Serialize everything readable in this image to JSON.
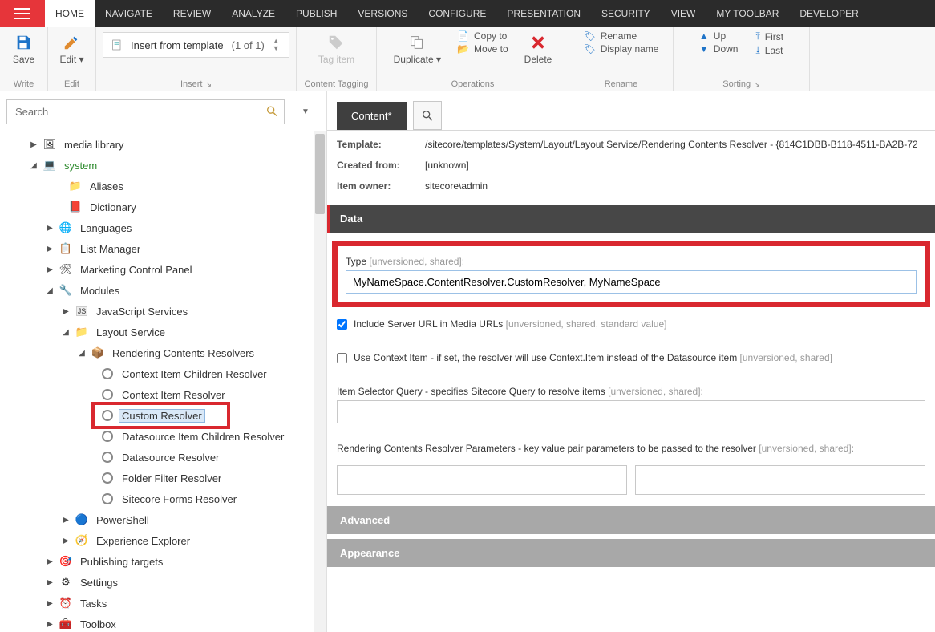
{
  "topMenu": {
    "items": [
      "HOME",
      "NAVIGATE",
      "REVIEW",
      "ANALYZE",
      "PUBLISH",
      "VERSIONS",
      "CONFIGURE",
      "PRESENTATION",
      "SECURITY",
      "VIEW",
      "MY TOOLBAR",
      "DEVELOPER"
    ],
    "activeIndex": 0
  },
  "ribbon": {
    "write": {
      "save": "Save",
      "group": "Write"
    },
    "edit": {
      "edit": "Edit",
      "group": "Edit"
    },
    "insert": {
      "label": "Insert from template",
      "count": "(1 of 1)",
      "group": "Insert"
    },
    "tagging": {
      "tag": "Tag item",
      "group": "Content Tagging"
    },
    "operations": {
      "duplicate": "Duplicate",
      "copy": "Copy to",
      "move": "Move to",
      "delete": "Delete",
      "group": "Operations"
    },
    "rename": {
      "rename": "Rename",
      "display": "Display name",
      "group": "Rename"
    },
    "sorting": {
      "up": "Up",
      "down": "Down",
      "first": "First",
      "last": "Last",
      "group": "Sorting"
    }
  },
  "search": {
    "placeholder": "Search"
  },
  "tree": {
    "n0": "media library",
    "n1": "system",
    "n2": "Aliases",
    "n3": "Dictionary",
    "n4": "Languages",
    "n5": "List Manager",
    "n6": "Marketing Control Panel",
    "n7": "Modules",
    "n8": "JavaScript Services",
    "n9": "Layout Service",
    "n10": "Rendering Contents Resolvers",
    "n11": "Context Item Children Resolver",
    "n12": "Context Item Resolver",
    "n13": "Custom Resolver",
    "n14": "Datasource Item Children Resolver",
    "n15": "Datasource Resolver",
    "n16": "Folder Filter Resolver",
    "n17": "Sitecore Forms Resolver",
    "n18": "PowerShell",
    "n19": "Experience Explorer",
    "n20": "Publishing targets",
    "n21": "Settings",
    "n22": "Tasks",
    "n23": "Toolbox"
  },
  "content": {
    "tab": "Content*",
    "meta": {
      "templateLabel": "Template:",
      "templateValue": "/sitecore/templates/System/Layout/Layout Service/Rendering Contents Resolver - {814C1DBB-B118-4511-BA2B-72",
      "createdLabel": "Created from:",
      "createdValue": "[unknown]",
      "ownerLabel": "Item owner:",
      "ownerValue": "sitecore\\admin"
    },
    "sections": {
      "data": "Data",
      "advanced": "Advanced",
      "appearance": "Appearance"
    },
    "fields": {
      "typeLabel": "Type",
      "typeHint": "[unversioned, shared]:",
      "typeValue": "MyNameSpace.ContentResolver.CustomResolver, MyNameSpace",
      "includeLabel": "Include Server URL in Media URLs",
      "includeHint": "[unversioned, shared, standard value]",
      "useContextLabel": "Use Context Item - if set, the resolver will use Context.Item instead of the Datasource item",
      "useContextHint": "[unversioned, shared]",
      "selectorLabel": "Item Selector Query - specifies Sitecore Query to resolve items",
      "selectorHint": "[unversioned, shared]:",
      "paramsLabel": "Rendering Contents Resolver Parameters - key value pair parameters to be passed to the resolver",
      "paramsHint": "[unversioned, shared]:"
    }
  }
}
